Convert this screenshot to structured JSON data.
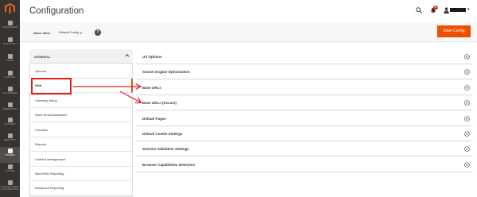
{
  "nav": {
    "items": [
      {
        "label": "DASHBOARD",
        "icon": "dashboard-icon"
      },
      {
        "label": "INVENTORY",
        "icon": "inventory-icon"
      },
      {
        "label": "SALES",
        "icon": "sales-icon"
      },
      {
        "label": "CATALOG",
        "icon": "catalog-icon"
      },
      {
        "label": "CUSTOMERS",
        "icon": "customers-icon"
      },
      {
        "label": "MARKETING",
        "icon": "marketing-icon"
      },
      {
        "label": "CONTENT",
        "icon": "content-icon"
      },
      {
        "label": "REPORTS",
        "icon": "reports-icon"
      },
      {
        "label": "STORES",
        "icon": "stores-icon"
      },
      {
        "label": "SYSTEM",
        "icon": "system-icon"
      },
      {
        "label": "FIND PARTNERS & EXTENSIONS",
        "icon": "partners-icon"
      }
    ],
    "active": "STORES"
  },
  "header": {
    "title": "Configuration",
    "notification_count": "10"
  },
  "store_view": {
    "label": "Store View:",
    "value": "Default Config",
    "help": "?"
  },
  "actions": {
    "save_label": "Save Config"
  },
  "config_tabs": {
    "group_label": "GENERAL",
    "items": [
      {
        "label": "General"
      },
      {
        "label": "Web"
      },
      {
        "label": "Currency Setup"
      },
      {
        "label": "Store Email Addresses"
      },
      {
        "label": "Contacts"
      },
      {
        "label": "Reports"
      },
      {
        "label": "Content Management"
      },
      {
        "label": "New Relic Reporting"
      },
      {
        "label": "Advanced Reporting"
      }
    ],
    "active": "Web"
  },
  "sections": [
    {
      "title": "Url Options"
    },
    {
      "title": "Search Engine Optimization"
    },
    {
      "title": "Base URLs"
    },
    {
      "title": "Base URLs (Secure)"
    },
    {
      "title": "Default Pages"
    },
    {
      "title": "Default Cookie Settings"
    },
    {
      "title": "Session Validation Settings"
    },
    {
      "title": "Browser Capabilities Detection"
    }
  ],
  "colors": {
    "nav_bg": "#373330",
    "accent": "#eb5202",
    "annotation": "#e31d1d"
  }
}
